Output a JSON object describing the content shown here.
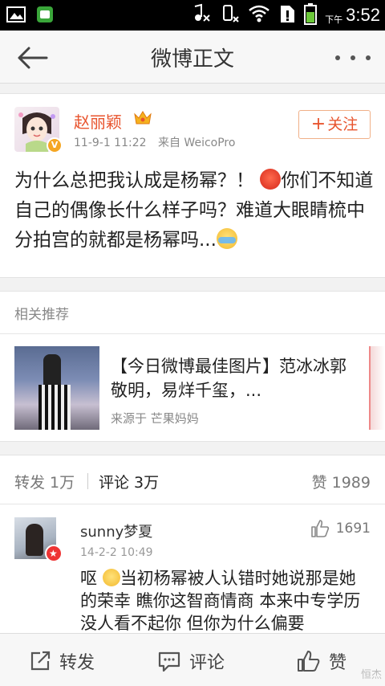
{
  "status_bar": {
    "ampm": "下午",
    "time": "3:52"
  },
  "header": {
    "title": "微博正文"
  },
  "post": {
    "author": "赵丽颖",
    "date": "11-9-1 11:22",
    "source": "来自 WeicoPro",
    "follow_label": "关注",
    "follow_plus": "+",
    "verified_badge": "V",
    "text_part1": "为什么总把我认成是杨幂？！",
    "text_part2": "你们不知道自己的偶像长什么样子吗？难道大眼睛梳中分拍宫的就都是杨幂吗...",
    "emoji_icons": [
      "angry-emoji-icon",
      "crying-emoji-icon"
    ]
  },
  "recommend": {
    "section_title": "相关推荐",
    "item_title": "【今日微博最佳图片】范冰冰郭敬明，易烊千玺，...",
    "item_source": "来源于 芒果妈妈"
  },
  "tabs": {
    "forward": "转发 1万",
    "comments": "评论 3万",
    "likes": "赞 1989"
  },
  "comment": {
    "user": "sunny梦夏",
    "date": "14-2-2 10:49",
    "like_count": "1691",
    "text_part1": "呕",
    "text_part2": "当初杨幂被人认错时她说那是她的荣幸 瞧你这智商情商 本来中专学历没人看不起你 但你为什么偏要"
  },
  "bottom_bar": {
    "forward": "转发",
    "comment": "评论",
    "like": "赞"
  },
  "watermark": "恒杰",
  "colors": {
    "accent": "#e8542e",
    "status_bar": "#000000",
    "background": "#f2f2f2"
  }
}
